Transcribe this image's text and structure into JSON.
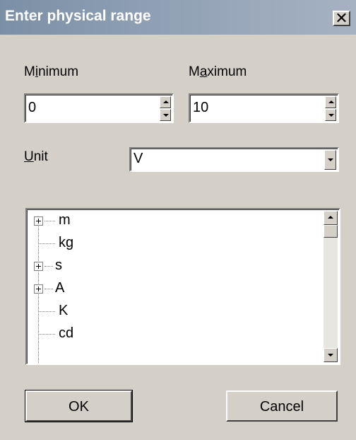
{
  "window": {
    "title": "Enter physical range",
    "close_glyph": "✕"
  },
  "minimum": {
    "label_pre": "M",
    "label_key": "i",
    "label_post": "nimum",
    "value": "0"
  },
  "maximum": {
    "label_pre": "M",
    "label_key": "a",
    "label_post": "ximum",
    "value": "10"
  },
  "unit": {
    "label_key": "U",
    "label_post": "nit",
    "value": "V"
  },
  "tree": {
    "items": [
      {
        "label": "m",
        "expandable": true
      },
      {
        "label": "kg",
        "expandable": false
      },
      {
        "label": "s",
        "expandable": true
      },
      {
        "label": "A",
        "expandable": true
      },
      {
        "label": "K",
        "expandable": false
      },
      {
        "label": "cd",
        "expandable": false
      }
    ]
  },
  "buttons": {
    "ok": "OK",
    "cancel": "Cancel"
  }
}
